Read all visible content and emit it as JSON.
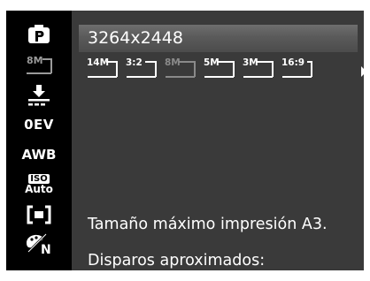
{
  "resolution_title": "3264x2448",
  "size_options": [
    {
      "label": "14M",
      "selected": false
    },
    {
      "label": "3:2",
      "selected": false
    },
    {
      "label": "8M",
      "selected": true
    },
    {
      "label": "5M",
      "selected": false
    },
    {
      "label": "3M",
      "selected": false
    },
    {
      "label": "16:9",
      "selected": false
    }
  ],
  "sidebar": {
    "mode_icon": "p-mode-icon",
    "image_size_label": "8M",
    "quality_icon": "quality-icon",
    "ev_label": "0EV",
    "wb_label": "AWB",
    "iso_label": "ISO",
    "iso_value": "Auto",
    "metering_icon": "metering-icon",
    "color_icon": "color-mode-icon",
    "color_label": "N"
  },
  "info": {
    "line1": "Tamaño máximo impresión A3.",
    "line2": "Disparos aproximados:"
  },
  "colors": {
    "background": "#3a3a3a",
    "sidebar": "#000000",
    "highlight": "#5e5e5e",
    "selected_option": "#8a8a8a",
    "text": "#ffffff"
  }
}
